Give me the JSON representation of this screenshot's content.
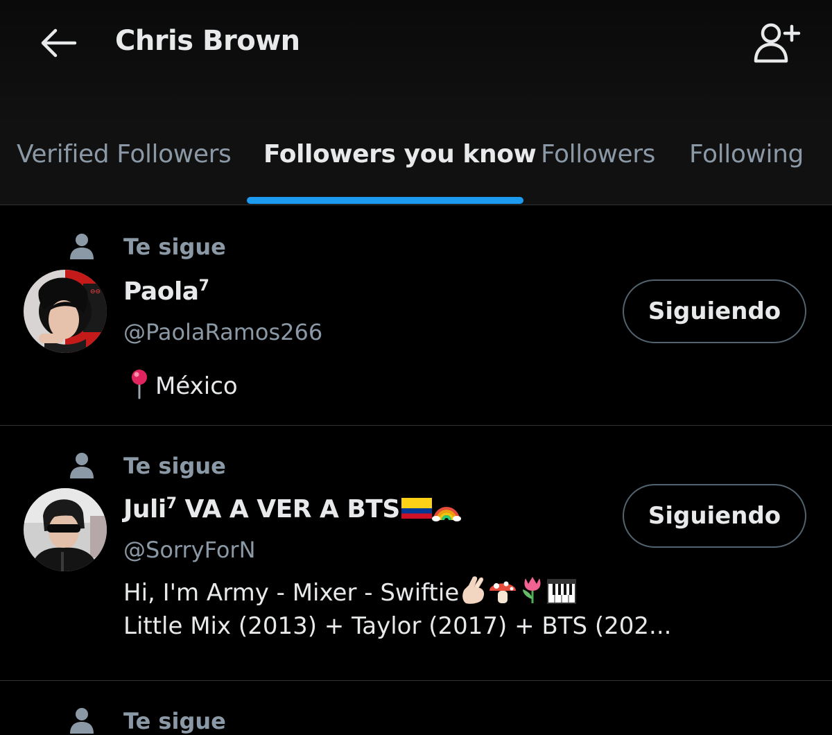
{
  "header": {
    "title": "Chris Brown",
    "back_icon": "arrow-left-icon",
    "add_user_icon": "person-plus-icon"
  },
  "tabs": [
    {
      "label": "Verified Followers",
      "active": false
    },
    {
      "label": "Followers you know",
      "active": true
    },
    {
      "label": "Followers",
      "active": false
    },
    {
      "label": "Following",
      "active": false
    }
  ],
  "colors": {
    "accent": "#1d9bf0",
    "background": "#000000",
    "secondary_text": "#8b98a5",
    "border": "#2f3336"
  },
  "users": [
    {
      "follows_you_label": "Te sigue",
      "display_name": "Paola",
      "name_superscript": "7",
      "handle": "@PaolaRamos266",
      "bio_location": "México",
      "button_label": "Siguiendo"
    },
    {
      "follows_you_label": "Te sigue",
      "display_name": "Juli",
      "name_superscript": "7",
      "name_rest": " VA A VER A BTS",
      "handle": "@SorryForN",
      "bio_line1": "Hi, I'm Army - Mixer - Swiftie",
      "bio_line2": "Little Mix (2013) + Taylor (2017) + BTS (202...",
      "button_label": "Siguiendo"
    },
    {
      "follows_you_label": "Te sigue"
    }
  ]
}
